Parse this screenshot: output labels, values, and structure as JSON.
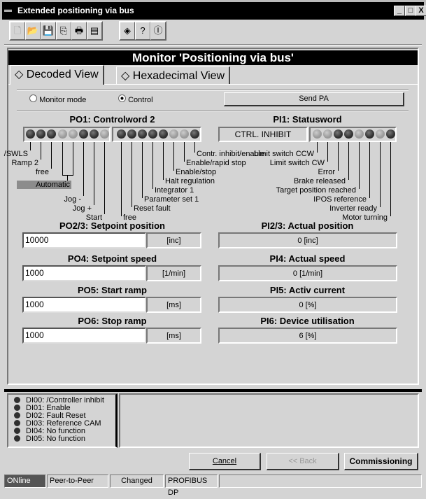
{
  "window": {
    "title": "Extended positioning via bus",
    "minimize": "_",
    "maximize": "□",
    "close": "X"
  },
  "toolbar": {
    "icons": [
      "new-icon",
      "open-icon",
      "save-icon",
      "copy-icon",
      "print-icon",
      "compare-icon",
      "info-sound-icon",
      "help-icon",
      "about-icon"
    ],
    "glyphs": [
      "🗋",
      "📂",
      "💾",
      "⎘",
      "🖶",
      "▤",
      "◈",
      "?",
      "Ⓘ"
    ]
  },
  "monitor": {
    "title": "Monitor 'Positioning via bus'",
    "tabs": [
      {
        "num": "1",
        "label": "Decoded View",
        "active": true
      },
      {
        "num": "2",
        "label": "Hexadecimal View",
        "active": false
      }
    ],
    "mode": {
      "monitor_label": "Monitor mode",
      "control_label": "Control",
      "selected": "Control"
    },
    "send_pa": "Send PA",
    "po1": {
      "title": "PO1: Controlword 2",
      "leds": [
        "off",
        "off",
        "off",
        "on",
        "on",
        "off",
        "off",
        "on",
        "off",
        "off",
        "off",
        "off",
        "off",
        "on",
        "on",
        "off"
      ],
      "labels_left": [
        "/SWLS",
        "Ramp 2",
        "free",
        "Jog -",
        "Jog +",
        "Start"
      ],
      "automatic": "Automatic",
      "labels_right": [
        "free",
        "Reset fault",
        "Parameter set 1",
        "Integrator 1",
        "Halt regulation",
        "Enable/stop",
        "Enable/rapid stop",
        "Contr. inhibit/enable"
      ]
    },
    "pi1": {
      "title": "PI1: Statusword",
      "state": "CTRL. INHIBIT",
      "leds": [
        "on",
        "on",
        "off",
        "off",
        "on",
        "off",
        "on",
        "off"
      ],
      "labels": [
        "Limit switch CCW",
        "Limit switch CW",
        "Error",
        "Brake released",
        "Target position reached",
        "IPOS reference",
        "Inverter ready",
        "Motor turning"
      ]
    },
    "outputs": [
      {
        "title": "PO2/3: Setpoint position",
        "value": "10000",
        "unit": "[inc]"
      },
      {
        "title": "PO4: Setpoint speed",
        "value": "1000",
        "unit": "[1/min]"
      },
      {
        "title": "PO5: Start ramp",
        "value": "1000",
        "unit": "[ms]"
      },
      {
        "title": "PO6: Stop ramp",
        "value": "1000",
        "unit": "[ms]"
      }
    ],
    "inputs": [
      {
        "title": "PI2/3: Actual position",
        "value": "0 [inc]"
      },
      {
        "title": "PI4: Actual speed",
        "value": "0 [1/min]"
      },
      {
        "title": "PI5: Activ current",
        "value": "0 [%]"
      },
      {
        "title": "PI6: Device utilisation",
        "value": "6 [%]"
      }
    ]
  },
  "digital_inputs": [
    "DI00: /Controller inhibit",
    "DI01: Enable",
    "DI02: Fault Reset",
    "DI03: Reference CAM",
    "DI04: No function",
    "DI05: No function"
  ],
  "buttons": {
    "cancel": "Cancel",
    "back": "<< Back",
    "commissioning": "Commissioning"
  },
  "statusbar": [
    "ONline",
    "Peer-to-Peer",
    "Changed",
    "PROFIBUS DP"
  ],
  "colors": {
    "led_off": "#303030",
    "led_on": "#9a9a9a",
    "automatic_bar": "#8c8c8c",
    "online_bg": "#555555"
  }
}
